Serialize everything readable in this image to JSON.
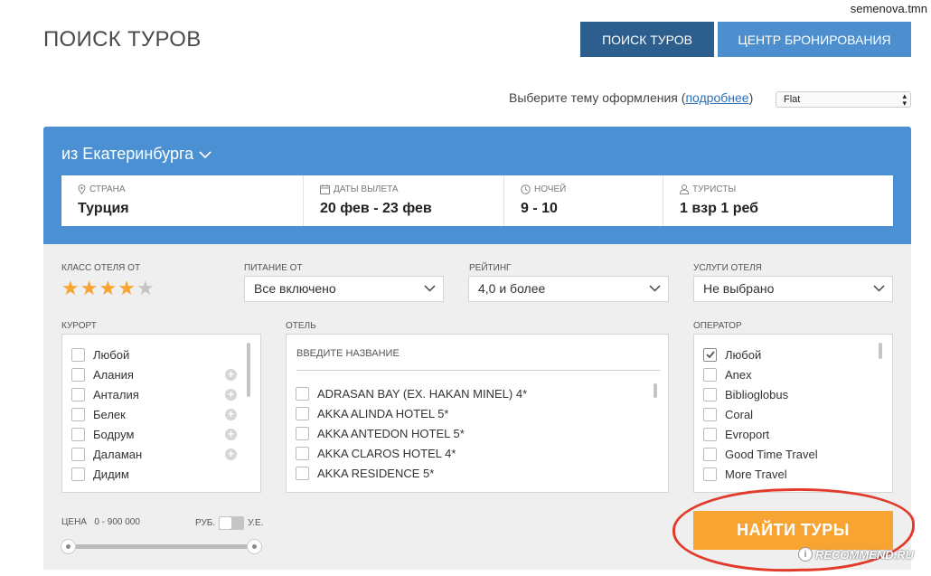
{
  "watermark_top": "semenova.tmn",
  "header": {
    "title": "ПОИСК ТУРОВ",
    "nav": [
      "ПОИСК ТУРОВ",
      "ЦЕНТР БРОНИРОВАНИЯ"
    ]
  },
  "theme": {
    "label_before": "Выберите тему оформления (",
    "link": "подробнее",
    "label_after": ")",
    "selected": "Flat"
  },
  "search": {
    "from_city": "из Екатеринбурга",
    "fields": [
      {
        "label": "СТРАНА",
        "value": "Турция",
        "icon": "map-pin-icon"
      },
      {
        "label": "ДАТЫ ВЫЛЕТА",
        "value": "20 фев - 23 фев",
        "icon": "calendar-icon"
      },
      {
        "label": "НОЧЕЙ",
        "value": "9 - 10",
        "icon": "clock-icon"
      },
      {
        "label": "ТУРИСТЫ",
        "value": "1 взр 1 реб",
        "icon": "user-icon"
      }
    ]
  },
  "filters": {
    "hotel_class_label": "КЛАСС ОТЕЛЯ ОТ",
    "hotel_class_stars": 4,
    "hotel_class_max": 5,
    "meal_label": "ПИТАНИЕ ОТ",
    "meal_value": "Все включено",
    "rating_label": "РЕЙТИНГ",
    "rating_value": "4,0 и более",
    "services_label": "УСЛУГИ ОТЕЛЯ",
    "services_value": "Не выбрано",
    "resort_label": "КУРОРТ",
    "resorts": [
      {
        "name": "Любой",
        "has_plus": false
      },
      {
        "name": "Алания",
        "has_plus": true
      },
      {
        "name": "Анталия",
        "has_plus": true
      },
      {
        "name": "Белек",
        "has_plus": true
      },
      {
        "name": "Бодрум",
        "has_plus": true
      },
      {
        "name": "Даламан",
        "has_plus": true
      },
      {
        "name": "Дидим",
        "has_plus": false
      }
    ],
    "hotel_label": "ОТЕЛЬ",
    "hotel_placeholder": "ВВЕДИТЕ НАЗВАНИЕ",
    "hotels": [
      "ADRASAN BAY (EX. HAKAN MINEL) 4*",
      "AKKA ALINDA HOTEL 5*",
      "AKKA ANTEDON HOTEL 5*",
      "AKKA CLAROS HOTEL 4*",
      "AKKA RESIDENCE 5*"
    ],
    "operator_label": "ОПЕРАТОР",
    "operators": [
      {
        "name": "Любой",
        "checked": true
      },
      {
        "name": "Anex",
        "checked": false
      },
      {
        "name": "Biblioglobus",
        "checked": false
      },
      {
        "name": "Coral",
        "checked": false
      },
      {
        "name": "Evroport",
        "checked": false
      },
      {
        "name": "Good Time Travel",
        "checked": false
      },
      {
        "name": "More Travel",
        "checked": false
      }
    ],
    "price_label": "ЦЕНА",
    "price_range": "0 -  900 000",
    "currency_left": "РУБ.",
    "currency_right": "У.Е."
  },
  "find_button": "НАЙТИ ТУРЫ",
  "watermark_bottom": "RECOMMEND.RU",
  "colors": {
    "dark_blue": "#2c5f8d",
    "light_blue": "#4d8fce",
    "panel_blue": "#4a90d2",
    "star": "#f7a432",
    "button_orange": "#f7a432",
    "annotation_red": "#e23b2c"
  }
}
